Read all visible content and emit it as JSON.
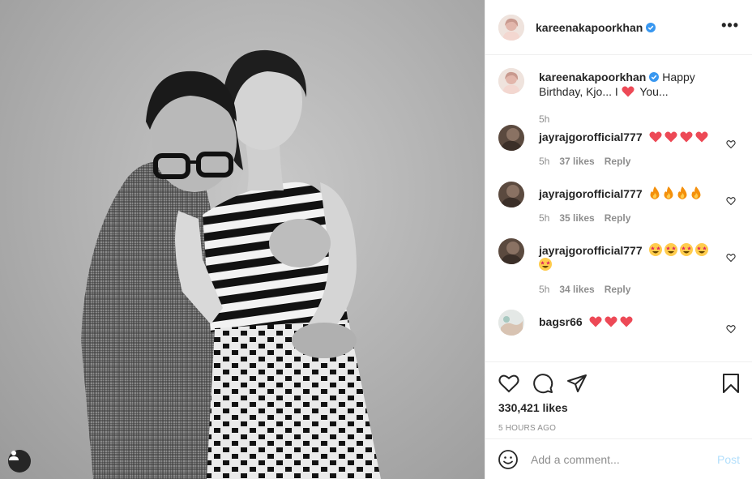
{
  "post": {
    "author": "kareenakapoorkhan",
    "verified": true,
    "likes_text": "330,421 likes",
    "time_ago": "5 HOURS AGO"
  },
  "caption": {
    "username": "kareenakapoorkhan",
    "text_before": "Happy Birthday, Kjo... I",
    "text_after": "You...",
    "time": "5h"
  },
  "comments": [
    {
      "username": "jayrajgorofficial777",
      "emoji": "heart-emoji",
      "emoji_count": 4,
      "time": "5h",
      "likes": "37 likes",
      "reply": "Reply"
    },
    {
      "username": "jayrajgorofficial777",
      "emoji": "fire-emoji",
      "emoji_count": 4,
      "time": "5h",
      "likes": "35 likes",
      "reply": "Reply"
    },
    {
      "username": "jayrajgorofficial777",
      "emoji": "star-struck-emoji",
      "emoji_count": 5,
      "time": "5h",
      "likes": "34 likes",
      "reply": "Reply"
    },
    {
      "username": "bagsr66",
      "emoji": "heart-emoji",
      "emoji_count": 3
    }
  ],
  "add_comment": {
    "placeholder": "Add a comment...",
    "post_label": "Post"
  },
  "colors": {
    "verified": "#3897f0",
    "heart_red": "#ed4956",
    "post_disabled": "#b2dffc",
    "muted": "#8e8e8e"
  },
  "icons": [
    "more-options-icon",
    "like-icon",
    "comment-icon",
    "share-icon",
    "save-icon",
    "smiley-icon",
    "user-tag-icon"
  ]
}
